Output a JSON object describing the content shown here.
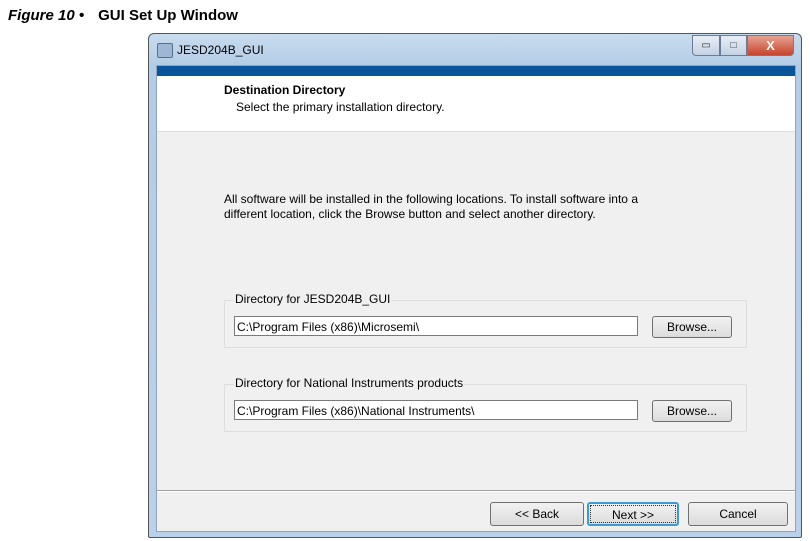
{
  "caption": {
    "figure": "Figure 10 •",
    "title": "GUI Set Up Window"
  },
  "window": {
    "title": "JESD204B_GUI",
    "controls": {
      "minimize": "▭",
      "maximize": "□",
      "close": "X"
    }
  },
  "header": {
    "title": "Destination Directory",
    "subtitle": "Select the primary installation directory."
  },
  "intro": "All software will be installed in the following locations. To install software into a different location, click the Browse button and select another directory.",
  "directories": [
    {
      "label": "Directory for JESD204B_GUI",
      "path": "C:\\Program Files (x86)\\Microsemi\\",
      "browse": "Browse..."
    },
    {
      "label": "Directory for National Instruments products",
      "path": "C:\\Program Files (x86)\\National Instruments\\",
      "browse": "Browse..."
    }
  ],
  "buttons": {
    "back": "<< Back",
    "next": "Next >>",
    "cancel": "Cancel"
  }
}
